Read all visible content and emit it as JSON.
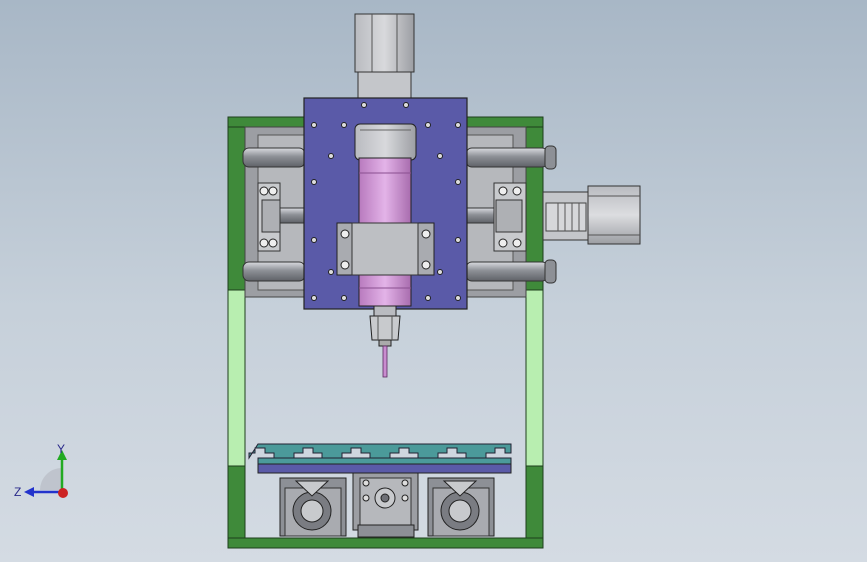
{
  "viewport": {
    "background_top": "#a8b7c6",
    "background_bottom": "#d4dbe3"
  },
  "model": {
    "frame_color": "#3f8a3a",
    "frame_light_color": "#b8eeb0",
    "plate_color": "#5a5aa8",
    "spindle_color": "#c98ccf",
    "profile_color": "#4b9a9a",
    "steel_color": "#a9abb0"
  },
  "triad": {
    "y_label": "Y",
    "z_label": "Z",
    "y_axis_color": "#22aa22",
    "z_axis_color": "#2233cc",
    "x_axis_color": "#cc2222"
  }
}
